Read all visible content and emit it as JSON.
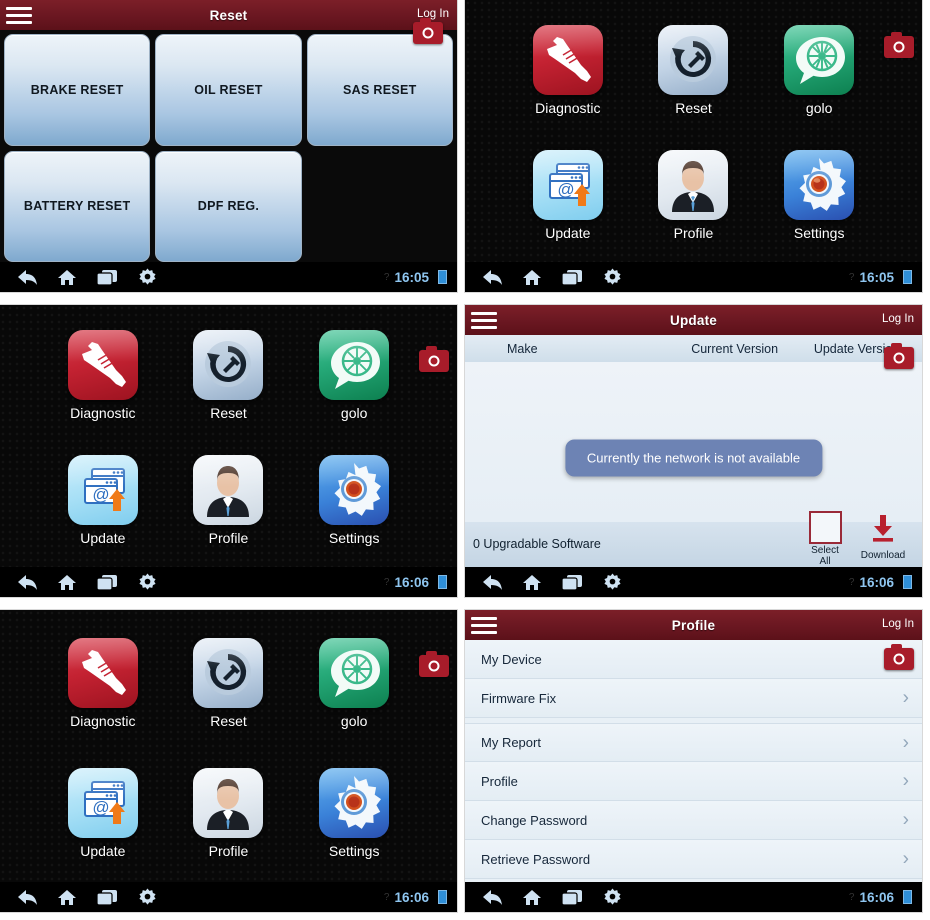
{
  "meta": {
    "accent_red": "#7c1f28",
    "camera_red": "#a81c2a",
    "clock_blue": "#8fc6f0"
  },
  "nav": {
    "back": "back-arrow-icon",
    "home": "home-icon",
    "recents": "recent-apps-icon",
    "settings": "gear-icon",
    "question": "?"
  },
  "panels": {
    "reset": {
      "title": "Reset",
      "login": "Log In",
      "time": "16:05",
      "buttons": [
        "BRAKE RESET",
        "OIL RESET",
        "SAS RESET",
        "BATTERY RESET",
        "DPF REG.",
        ""
      ]
    },
    "home_a": {
      "time": "16:05",
      "apps": [
        {
          "label": "Diagnostic",
          "icon": "wrench-icon"
        },
        {
          "label": "Reset",
          "icon": "reset-wrench-icon"
        },
        {
          "label": "golo",
          "icon": "golo-chat-wheel-icon"
        },
        {
          "label": "Update",
          "icon": "update-browser-icon"
        },
        {
          "label": "Profile",
          "icon": "person-icon"
        },
        {
          "label": "Settings",
          "icon": "gear-icon"
        }
      ]
    },
    "home_b": {
      "time": "16:06",
      "apps": [
        {
          "label": "Diagnostic",
          "icon": "wrench-icon"
        },
        {
          "label": "Reset",
          "icon": "reset-wrench-icon"
        },
        {
          "label": "golo",
          "icon": "golo-chat-wheel-icon"
        },
        {
          "label": "Update",
          "icon": "update-browser-icon"
        },
        {
          "label": "Profile",
          "icon": "person-icon"
        },
        {
          "label": "Settings",
          "icon": "gear-icon"
        }
      ]
    },
    "home_c": {
      "time": "16:06",
      "apps": [
        {
          "label": "Diagnostic",
          "icon": "wrench-icon"
        },
        {
          "label": "Reset",
          "icon": "reset-wrench-icon"
        },
        {
          "label": "golo",
          "icon": "golo-chat-wheel-icon"
        },
        {
          "label": "Update",
          "icon": "update-browser-icon"
        },
        {
          "label": "Profile",
          "icon": "person-icon"
        },
        {
          "label": "Settings",
          "icon": "gear-icon"
        }
      ]
    },
    "update": {
      "title": "Update",
      "login": "Log In",
      "time": "16:06",
      "columns": [
        "Make",
        "Current Version",
        "Update Version"
      ],
      "toast": "Currently the network is not available",
      "count_label": "0 Upgradable Software",
      "select_all": "Select All",
      "download": "Download"
    },
    "profile": {
      "title": "Profile",
      "login": "Log In",
      "time": "16:06",
      "rows": [
        {
          "label": "My Device",
          "group_start": false
        },
        {
          "label": "Firmware Fix",
          "group_start": false
        },
        {
          "label": "My Report",
          "group_start": true
        },
        {
          "label": "Profile",
          "group_start": false
        },
        {
          "label": "Change Password",
          "group_start": false
        },
        {
          "label": "Retrieve Password",
          "group_start": false
        }
      ],
      "chevron": "›"
    }
  }
}
